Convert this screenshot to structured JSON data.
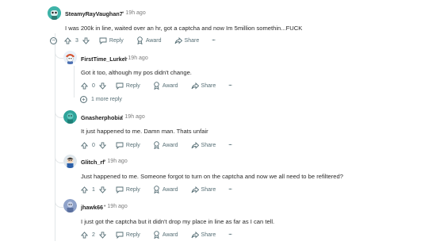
{
  "comments": [
    {
      "username": "SteamyRayVaughan7",
      "time": "19h ago",
      "text": "I was 200k in line, waited over an hr, got a captcha and now Im 5million somethin...FUCK",
      "votes": "3",
      "reply_label": "Reply",
      "award_label": "Award",
      "share_label": "Share",
      "more_label": "···",
      "collapse_glyph": "−"
    },
    {
      "username": "FirstTime_Lurker",
      "time": "19h ago",
      "text": "Got it too, although my pos didn't change.",
      "votes": "0",
      "reply_label": "Reply",
      "award_label": "Award",
      "share_label": "Share",
      "more_label": "···",
      "more_replies": "1 more reply",
      "more_replies_glyph": "+"
    },
    {
      "username": "Gnasherphobia",
      "time": "19h ago",
      "text": "It just happened to me. Damn man. Thats unfair",
      "votes": "0",
      "reply_label": "Reply",
      "award_label": "Award",
      "share_label": "Share",
      "more_label": "···"
    },
    {
      "username": "Glitch_rf",
      "time": "19h ago",
      "text": "Just happened to me. Someone forgot to turn on the captcha and now we all need to be refiltered?",
      "votes": "1",
      "reply_label": "Reply",
      "award_label": "Award",
      "share_label": "Share",
      "more_label": "···"
    },
    {
      "username": "jhawk66",
      "time": "19h ago",
      "text": "I just got the captcha but it didn't drop my place in line as far as I can tell.",
      "votes": "2",
      "reply_label": "Reply",
      "award_label": "Award",
      "share_label": "Share",
      "more_label": "···"
    }
  ],
  "separator": "•",
  "colors": {
    "action_text": "#576f76",
    "meta_text": "#7c7c7c",
    "thread_line": "#e2e6e8",
    "avatar_teal": "#3fb3a8",
    "avatar_blue_grey": "#8fa2c9"
  }
}
